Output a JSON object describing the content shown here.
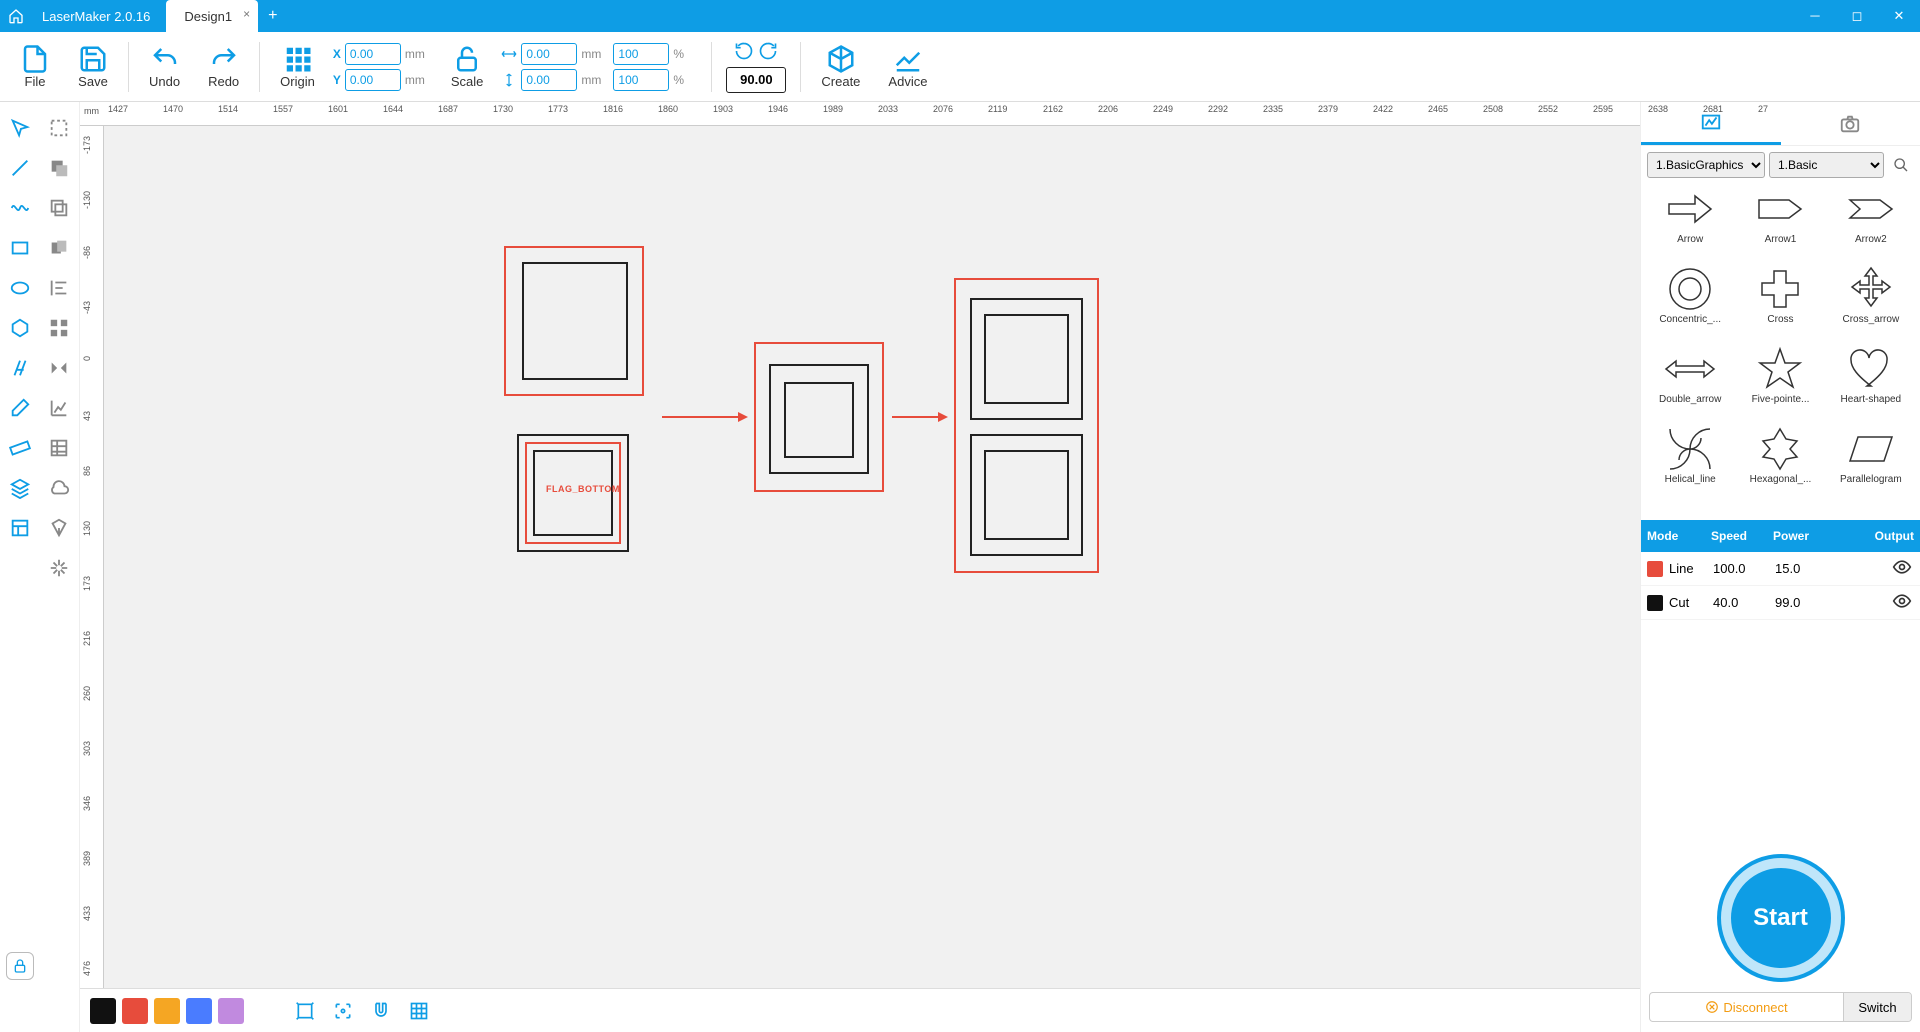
{
  "app": {
    "name": "LaserMaker 2.0.16",
    "tab": "Design1"
  },
  "toolbar": {
    "file": "File",
    "save": "Save",
    "undo": "Undo",
    "redo": "Redo",
    "origin": "Origin",
    "scale": "Scale",
    "create": "Create",
    "advice": "Advice",
    "coords": {
      "xlabel": "X",
      "ylabel": "Y",
      "xval": "0.00",
      "yval": "0.00",
      "unit": "mm"
    },
    "size": {
      "wval": "0.00",
      "hval": "0.00",
      "wpct": "100",
      "hpct": "100",
      "unit": "mm",
      "pct": "%"
    },
    "rotation": "90.00"
  },
  "ruler": {
    "unit": "mm",
    "h": [
      "1427",
      "1470",
      "1514",
      "1557",
      "1601",
      "1644",
      "1687",
      "1730",
      "1773",
      "1816",
      "1860",
      "1903",
      "1946",
      "1989",
      "2033",
      "2076",
      "2119",
      "2162",
      "2206",
      "2249",
      "2292",
      "2335",
      "2379",
      "2422",
      "2465",
      "2508",
      "2552",
      "2595",
      "2638",
      "2681",
      "27"
    ],
    "v": [
      "-173",
      "-130",
      "-86",
      "-43",
      "0",
      "43",
      "86",
      "130",
      "173",
      "216",
      "260",
      "303",
      "346",
      "389",
      "433",
      "476"
    ]
  },
  "canvas_label": "FLAG_BOTTOM",
  "shapes_panel": {
    "dd1": "1.BasicGraphics",
    "dd2": "1.Basic",
    "items": [
      "Arrow",
      "Arrow1",
      "Arrow2",
      "Concentric_...",
      "Cross",
      "Cross_arrow",
      "Double_arrow",
      "Five-pointe...",
      "Heart-shaped",
      "Helical_line",
      "Hexagonal_...",
      "Parallelogram"
    ]
  },
  "layers": {
    "hdr": {
      "mode": "Mode",
      "speed": "Speed",
      "power": "Power",
      "output": "Output"
    },
    "rows": [
      {
        "color": "#e74c3c",
        "mode": "Line",
        "speed": "100.0",
        "power": "15.0"
      },
      {
        "color": "#111111",
        "mode": "Cut",
        "speed": "40.0",
        "power": "99.0"
      }
    ]
  },
  "controls": {
    "start": "Start",
    "disconnect": "Disconnect",
    "switch": "Switch"
  },
  "swatches": [
    "#111111",
    "#e74c3c",
    "#f5a623",
    "#4a7cff",
    "#c18adf"
  ]
}
